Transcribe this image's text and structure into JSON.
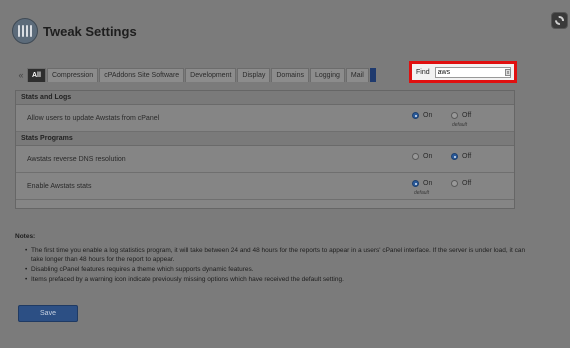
{
  "header": {
    "title": "Tweak Settings"
  },
  "tabs": [
    {
      "label": "All",
      "active": true
    },
    {
      "label": "Compression"
    },
    {
      "label": "cPAddons Site Software"
    },
    {
      "label": "Development"
    },
    {
      "label": "Display"
    },
    {
      "label": "Domains"
    },
    {
      "label": "Logging"
    },
    {
      "label": "Mail"
    }
  ],
  "find": {
    "label": "Find",
    "value": "aws",
    "clear_icon": "x"
  },
  "sections": [
    {
      "title": "Stats and Logs",
      "rows": [
        {
          "label": "Allow users to update Awstats from cPanel",
          "selected": "on",
          "default": "off"
        }
      ]
    },
    {
      "title": "Stats Programs",
      "rows": [
        {
          "label": "Awstats reverse DNS resolution",
          "selected": "off",
          "default": null
        },
        {
          "label": "Enable Awstats stats",
          "selected": "on",
          "default": "on"
        }
      ]
    }
  ],
  "options": {
    "on": "On",
    "off": "Off",
    "default": "default"
  },
  "notes": {
    "title": "Notes:",
    "items": [
      "The first time you enable a log statistics program, it will take between 24 and 48 hours for the reports to appear in a users' cPanel interface. If the server is under load, it can take longer than 48 hours for the report to appear.",
      "Disabling cPanel features requires a theme which supports dynamic features.",
      "Items prefaced by a warning icon indicate previously missing options which have received the default setting."
    ]
  },
  "save_label": "Save"
}
